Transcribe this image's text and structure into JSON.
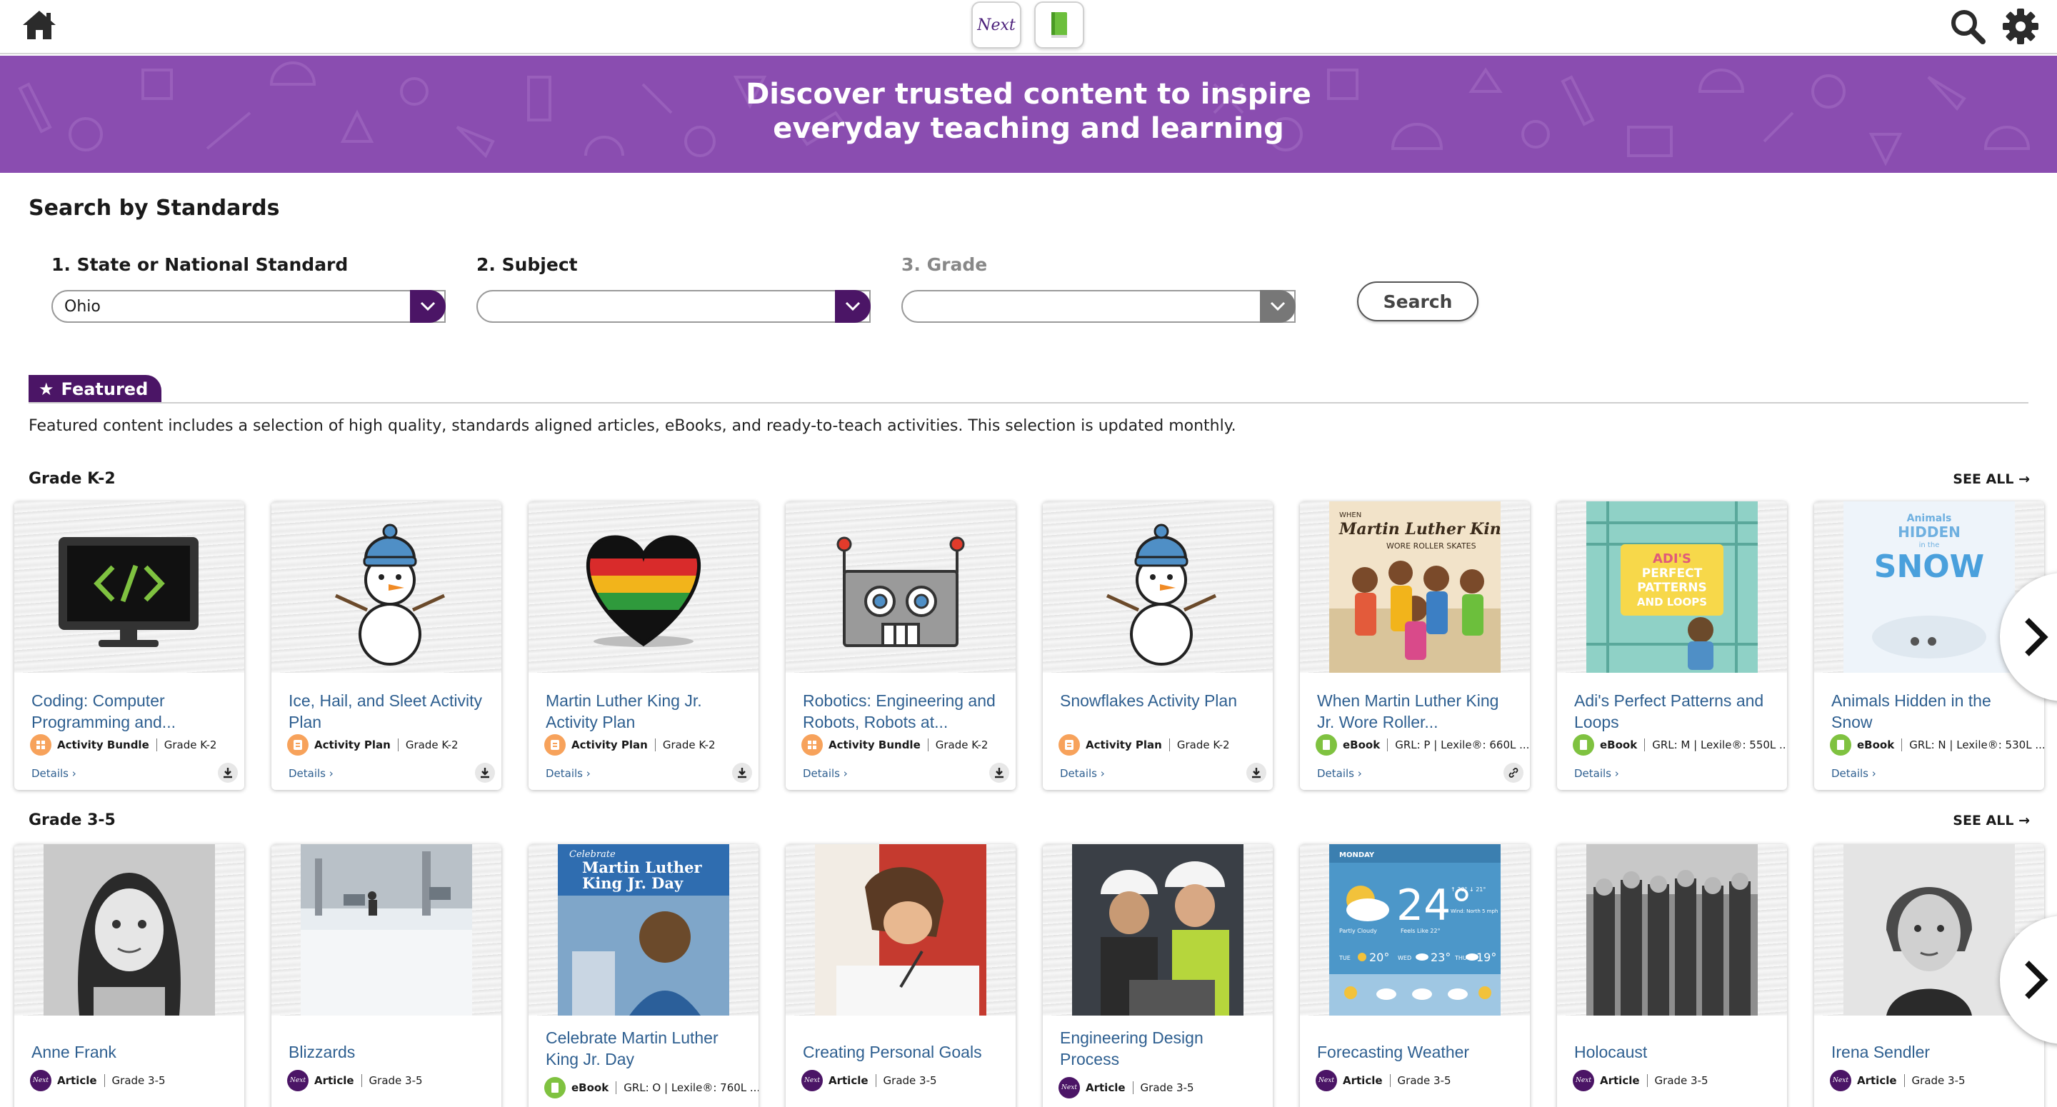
{
  "header": {
    "next_logo": "Next"
  },
  "banner": {
    "line1": "Discover trusted content to inspire",
    "line2": "everyday teaching and learning"
  },
  "search": {
    "title": "Search by Standards",
    "state_label": "1. State or National Standard",
    "state_value": "Ohio",
    "subject_label": "2. Subject",
    "subject_value": "",
    "grade_label": "3. Grade",
    "grade_value": "",
    "button": "Search"
  },
  "featured": {
    "tab": "Featured",
    "description": "Featured content includes a selection of high quality, standards aligned articles, eBooks, and ready-to-teach activities. This selection is updated monthly."
  },
  "rows": [
    {
      "title": "Grade K-2",
      "see_all": "SEE ALL →",
      "cards": [
        {
          "title": "Coding: Computer Programming and...",
          "type": "Activity Bundle",
          "info": "Grade K-2",
          "details": "Details ›"
        },
        {
          "title": "Ice, Hail, and Sleet Activity Plan",
          "type": "Activity Plan",
          "info": "Grade K-2",
          "details": "Details ›"
        },
        {
          "title": "Martin Luther King Jr. Activity Plan",
          "type": "Activity Plan",
          "info": "Grade K-2",
          "details": "Details ›"
        },
        {
          "title": "Robotics: Engineering and Robots, Robots at...",
          "type": "Activity Bundle",
          "info": "Grade K-2",
          "details": "Details ›"
        },
        {
          "title": "Snowflakes Activity Plan",
          "type": "Activity Plan",
          "info": "Grade K-2",
          "details": "Details ›"
        },
        {
          "title": "When Martin Luther King Jr. Wore Roller...",
          "type": "eBook",
          "info": "GRL: P | Lexile®: 660L ...",
          "details": "Details ›",
          "cover_line1": "WHEN",
          "cover_line2": "Martin Luther King Jr.",
          "cover_line3": "WORE ROLLER SKATES"
        },
        {
          "title": "Adi's Perfect Patterns and Loops",
          "type": "eBook",
          "info": "GRL: M | Lexile®: 550L ...",
          "details": "Details ›",
          "cover_line1": "ADI'S",
          "cover_line2": "PERFECT",
          "cover_line3": "PATTERNS",
          "cover_line4": "AND LOOPS"
        },
        {
          "title": "Animals Hidden in the Snow",
          "type": "eBook",
          "info": "GRL: N | Lexile®: 530L ...",
          "details": "Details ›",
          "cover_line1": "Animals",
          "cover_line2": "HIDDEN",
          "cover_line3": "in the",
          "cover_line4": "SNOW"
        }
      ]
    },
    {
      "title": "Grade 3-5",
      "see_all": "SEE ALL →",
      "cards": [
        {
          "title": "Anne Frank",
          "type": "Article",
          "info": "Grade 3-5"
        },
        {
          "title": "Blizzards",
          "type": "Article",
          "info": "Grade 3-5"
        },
        {
          "title": "Celebrate Martin Luther King Jr. Day",
          "type": "eBook",
          "info": "GRL: O | Lexile®: 760L ...",
          "cover_line1": "Celebrate",
          "cover_line2": "Martin Luther",
          "cover_line3": "King Jr. Day"
        },
        {
          "title": "Creating Personal Goals",
          "type": "Article",
          "info": "Grade 3-5"
        },
        {
          "title": "Engineering Design Process",
          "type": "Article",
          "info": "Grade 3-5"
        },
        {
          "title": "Forecasting Weather",
          "type": "Article",
          "info": "Grade 3-5",
          "weather": {
            "day": "MONDAY",
            "temp": "24°",
            "hilo": "↑ 30° ↓ 21°",
            "cond": "Partly Cloudy",
            "feels": "Feels Like 22°",
            "wind": "Wind: North 5 mph",
            "d1": "TUE",
            "t1": "20°",
            "d2": "WED",
            "t2": "23°",
            "d3": "THU",
            "t3": "19°"
          }
        },
        {
          "title": "Holocaust",
          "type": "Article",
          "info": "Grade 3-5"
        },
        {
          "title": "Irena Sendler",
          "type": "Article",
          "info": "Grade 3-5"
        }
      ]
    }
  ]
}
